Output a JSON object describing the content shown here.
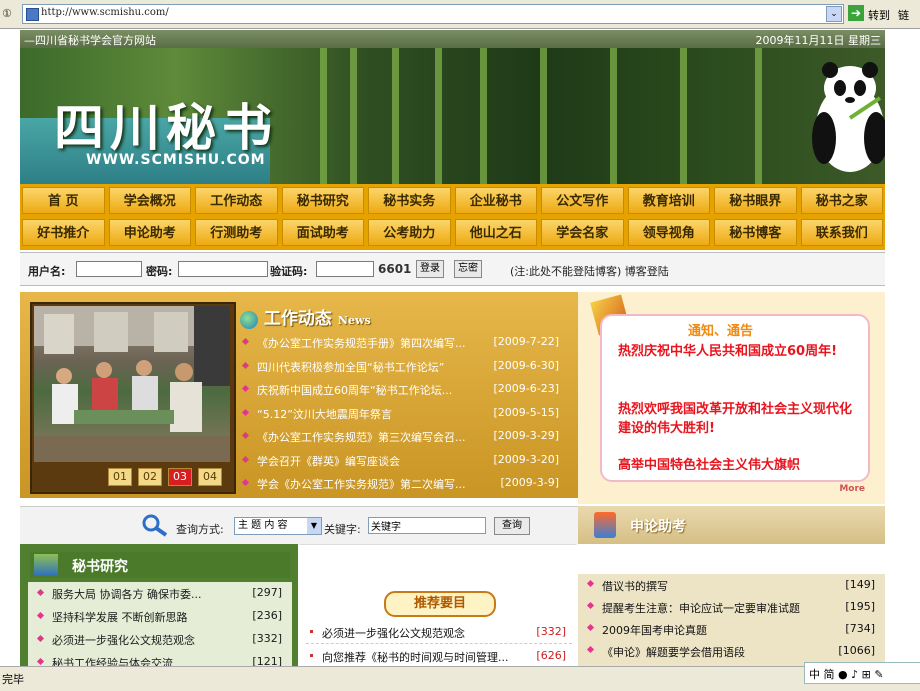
{
  "browser": {
    "address_label": "①",
    "url": "http://www.scmishu.com/",
    "dropdown": "⌄",
    "go_label": "转到",
    "links_label": "链"
  },
  "site": {
    "top_left": "—四川省秘书学会官方网站",
    "date": "2009年11月11日 星期三",
    "logo": "四川秘书",
    "logo_url": "WWW.SCMISHU.COM"
  },
  "nav": {
    "row1": [
      "首 页",
      "学会概况",
      "工作动态",
      "秘书研究",
      "秘书实务",
      "企业秘书",
      "公文写作",
      "教育培训",
      "秘书眼界",
      "秘书之家"
    ],
    "row2": [
      "好书推介",
      "申论助考",
      "行测助考",
      "面试助考",
      "公考助力",
      "他山之石",
      "学会名家",
      "领导视角",
      "秘书博客",
      "联系我们"
    ]
  },
  "login": {
    "username_label": "用户名:",
    "password_label": "密码:",
    "captcha_label": "验证码:",
    "captcha_code": "6601",
    "login_button": "登录",
    "forgot_button": "忘密",
    "note": "(注:此处不能登陆博客) 博客登陆"
  },
  "photo_pager": [
    "01",
    "02",
    "03",
    "04"
  ],
  "news": {
    "title": "工作动态",
    "title_en": "News",
    "items": [
      {
        "title": "《办公室工作实务规范手册》第四次编写...",
        "date": "[2009-7-22]"
      },
      {
        "title": "四川代表积极参加全国“秘书工作论坛”",
        "date": "[2009-6-30]"
      },
      {
        "title": "庆祝新中国成立60周年“秘书工作论坛...",
        "date": "[2009-6-23]"
      },
      {
        "title": "“5.12”汶川大地震周年祭言",
        "date": "[2009-5-15]"
      },
      {
        "title": "《办公室工作实务规范》第三次编写会召...",
        "date": "[2009-3-29]"
      },
      {
        "title": "学会召开《群英》编写座谈会",
        "date": "[2009-3-20]"
      },
      {
        "title": "学会《办公室工作实务规范》第二次编写...",
        "date": "[2009-3-9]"
      }
    ]
  },
  "notice": {
    "title": "通知、通告",
    "line1": "热烈庆祝中华人民共和国成立60周年!",
    "line2": "热烈欢呼我国改革开放和社会主义现代化建设的伟大胜利!",
    "line3": "高举中国特色社会主义伟大旗帜",
    "more": "More"
  },
  "search": {
    "method_label": "查询方式:",
    "method_value": "主 题 内 容",
    "keyword_label": "关键字:",
    "keyword_value": "关键字",
    "button": "查询"
  },
  "shenlun": {
    "title": "申论助考"
  },
  "mishu": {
    "title": "秘书研究",
    "items": [
      {
        "title": "服务大局 协调各方 确保市委...",
        "count": "[297]"
      },
      {
        "title": "坚持科学发展 不断创新思路",
        "count": "[236]"
      },
      {
        "title": "必须进一步强化公文规范观念",
        "count": "[332]"
      },
      {
        "title": "秘书工作经验与体会交流",
        "count": "[121]"
      }
    ]
  },
  "recommend": {
    "title": "推荐要目",
    "items": [
      {
        "title": "必须进一步强化公文规范观念",
        "count": "[332]"
      },
      {
        "title": "向您推荐《秘书的时间观与时间管理...",
        "count": "[626]"
      }
    ]
  },
  "shenlun_list": [
    {
      "title": "借议书的撰写",
      "count": "[149]"
    },
    {
      "title": "提醒考生注意：申论应试一定要审准试题",
      "count": "[195]"
    },
    {
      "title": "2009年国考申论真题",
      "count": "[734]"
    },
    {
      "title": "《申论》解题要学会借用语段",
      "count": "[1066]"
    }
  ],
  "status": {
    "text": "完毕"
  },
  "ime": {
    "text": "中 简 ● ♪ ⊞ ✎"
  }
}
